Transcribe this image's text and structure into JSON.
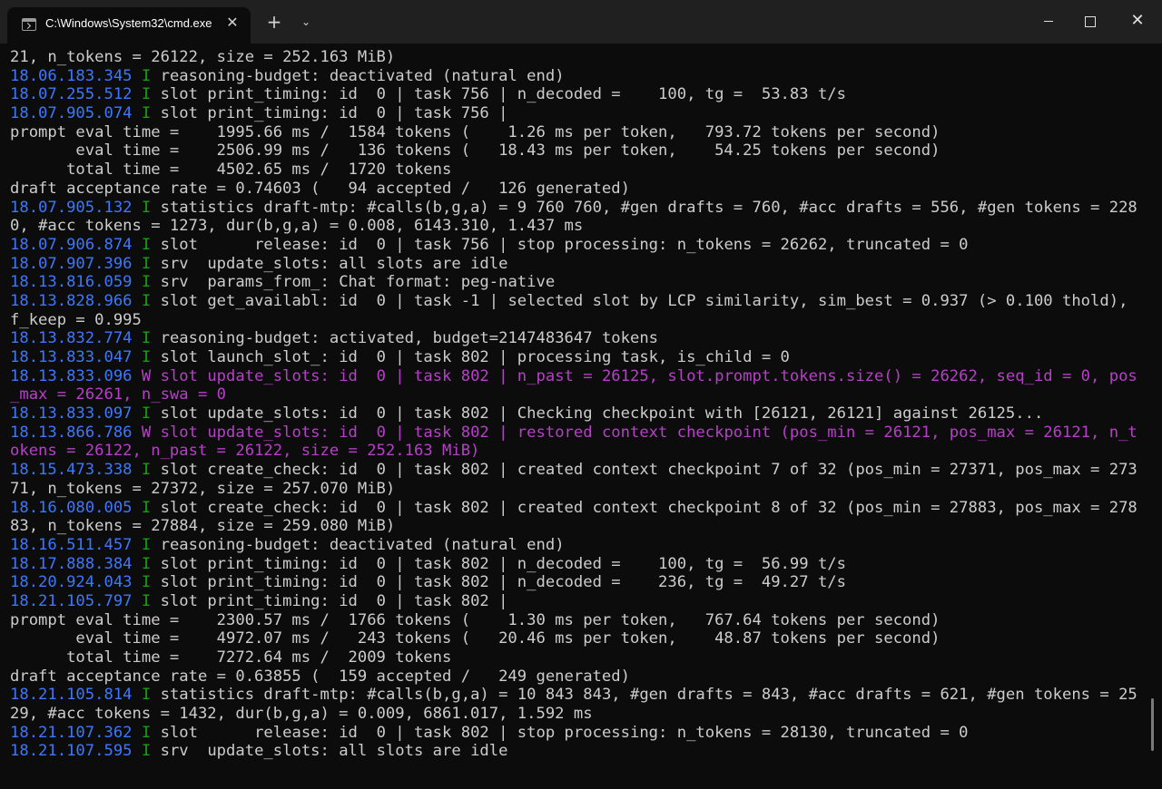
{
  "window": {
    "tab_title": "C:\\Windows\\System32\\cmd.exe",
    "tab_close": "✕",
    "new_tab": "+",
    "tab_dropdown": "⌄",
    "close_glyph": "✕"
  },
  "icons": [
    "terminal-icon",
    "close-icon",
    "plus-icon",
    "chevron-down-icon",
    "minimize-icon",
    "maximize-icon"
  ],
  "colors": {
    "timestamp": "#3b78ff",
    "info_level": "#13a10e",
    "warn": "#b640c7",
    "text": "#cccccc",
    "background": "#0c0c0c",
    "titlebar": "#202020"
  },
  "terminal": {
    "lines": [
      {
        "text": "21, n_tokens = 26122, size = 252.163 MiB)"
      },
      {
        "ts": "18.06.183.345",
        "lvl": "I",
        "text": " reasoning-budget: deactivated (natural end)"
      },
      {
        "ts": "18.07.255.512",
        "lvl": "I",
        "text": " slot print_timing: id  0 | task 756 | n_decoded =    100, tg =  53.83 t/s"
      },
      {
        "ts": "18.07.905.074",
        "lvl": "I",
        "text": " slot print_timing: id  0 | task 756 |"
      },
      {
        "text": "prompt eval time =    1995.66 ms /  1584 tokens (    1.26 ms per token,   793.72 tokens per second)"
      },
      {
        "text": "       eval time =    2506.99 ms /   136 tokens (   18.43 ms per token,    54.25 tokens per second)"
      },
      {
        "text": "      total time =    4502.65 ms /  1720 tokens"
      },
      {
        "text": "draft acceptance rate = 0.74603 (   94 accepted /   126 generated)"
      },
      {
        "ts": "18.07.905.132",
        "lvl": "I",
        "text": " statistics draft-mtp: #calls(b,g,a) = 9 760 760, #gen drafts = 760, #acc drafts = 556, #gen tokens = 228"
      },
      {
        "text": "0, #acc tokens = 1273, dur(b,g,a) = 0.008, 6143.310, 1.437 ms"
      },
      {
        "ts": "18.07.906.874",
        "lvl": "I",
        "text": " slot      release: id  0 | task 756 | stop processing: n_tokens = 26262, truncated = 0"
      },
      {
        "ts": "18.07.907.396",
        "lvl": "I",
        "text": " srv  update_slots: all slots are idle"
      },
      {
        "ts": "18.13.816.059",
        "lvl": "I",
        "text": " srv  params_from_: Chat format: peg-native"
      },
      {
        "ts": "18.13.828.966",
        "lvl": "I",
        "text": " slot get_availabl: id  0 | task -1 | selected slot by LCP similarity, sim_best = 0.937 (> 0.100 thold),"
      },
      {
        "text": "f_keep = 0.995"
      },
      {
        "ts": "18.13.832.774",
        "lvl": "I",
        "text": " reasoning-budget: activated, budget=2147483647 tokens"
      },
      {
        "ts": "18.13.833.047",
        "lvl": "I",
        "text": " slot launch_slot_: id  0 | task 802 | processing task, is_child = 0"
      },
      {
        "ts": "18.13.833.096",
        "lvl": "W",
        "warn": true,
        "text": " slot update_slots: id  0 | task 802 | n_past = 26125, slot.prompt.tokens.size() = 26262, seq_id = 0, pos"
      },
      {
        "warn": true,
        "text": "_max = 26261, n_swa = 0"
      },
      {
        "ts": "18.13.833.097",
        "lvl": "I",
        "text": " slot update_slots: id  0 | task 802 | Checking checkpoint with [26121, 26121] against 26125..."
      },
      {
        "ts": "18.13.866.786",
        "lvl": "W",
        "warn": true,
        "text": " slot update_slots: id  0 | task 802 | restored context checkpoint (pos_min = 26121, pos_max = 26121, n_t"
      },
      {
        "warn": true,
        "text": "okens = 26122, n_past = 26122, size = 252.163 MiB)"
      },
      {
        "ts": "18.15.473.338",
        "lvl": "I",
        "text": " slot create_check: id  0 | task 802 | created context checkpoint 7 of 32 (pos_min = 27371, pos_max = 273"
      },
      {
        "text": "71, n_tokens = 27372, size = 257.070 MiB)"
      },
      {
        "ts": "18.16.080.005",
        "lvl": "I",
        "text": " slot create_check: id  0 | task 802 | created context checkpoint 8 of 32 (pos_min = 27883, pos_max = 278"
      },
      {
        "text": "83, n_tokens = 27884, size = 259.080 MiB)"
      },
      {
        "ts": "18.16.511.457",
        "lvl": "I",
        "text": " reasoning-budget: deactivated (natural end)"
      },
      {
        "ts": "18.17.888.384",
        "lvl": "I",
        "text": " slot print_timing: id  0 | task 802 | n_decoded =    100, tg =  56.99 t/s"
      },
      {
        "ts": "18.20.924.043",
        "lvl": "I",
        "text": " slot print_timing: id  0 | task 802 | n_decoded =    236, tg =  49.27 t/s"
      },
      {
        "ts": "18.21.105.797",
        "lvl": "I",
        "text": " slot print_timing: id  0 | task 802 |"
      },
      {
        "text": "prompt eval time =    2300.57 ms /  1766 tokens (    1.30 ms per token,   767.64 tokens per second)"
      },
      {
        "text": "       eval time =    4972.07 ms /   243 tokens (   20.46 ms per token,    48.87 tokens per second)"
      },
      {
        "text": "      total time =    7272.64 ms /  2009 tokens"
      },
      {
        "text": "draft acceptance rate = 0.63855 (  159 accepted /   249 generated)"
      },
      {
        "ts": "18.21.105.814",
        "lvl": "I",
        "text": " statistics draft-mtp: #calls(b,g,a) = 10 843 843, #gen drafts = 843, #acc drafts = 621, #gen tokens = 25"
      },
      {
        "text": "29, #acc tokens = 1432, dur(b,g,a) = 0.009, 6861.017, 1.592 ms"
      },
      {
        "ts": "18.21.107.362",
        "lvl": "I",
        "text": " slot      release: id  0 | task 802 | stop processing: n_tokens = 28130, truncated = 0"
      },
      {
        "ts": "18.21.107.595",
        "lvl": "I",
        "text": " srv  update_slots: all slots are idle"
      }
    ]
  }
}
